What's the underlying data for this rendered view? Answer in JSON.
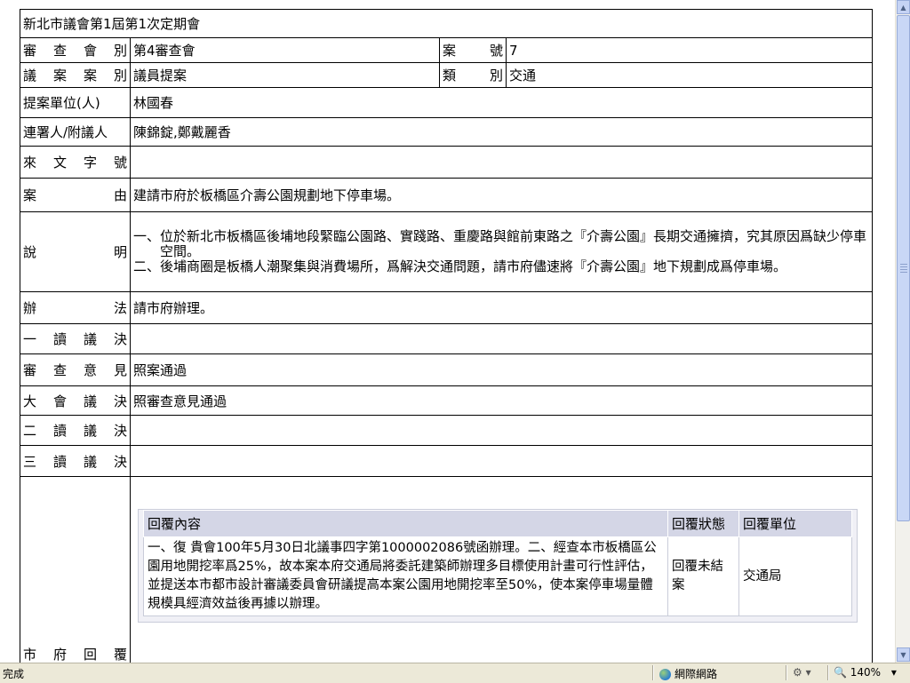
{
  "title": "新北市議會第1屆第1次定期會",
  "review": {
    "label": "審　查　會　別",
    "label_chars": [
      "審",
      "查",
      "會",
      "別"
    ],
    "value": "第4審查會"
  },
  "case_no": {
    "label_chars": [
      "案",
      "號"
    ],
    "value": "7"
  },
  "category": {
    "label_chars": [
      "議",
      "案",
      "案",
      "別"
    ],
    "value": "議員提案"
  },
  "type": {
    "label_chars": [
      "類",
      "別"
    ],
    "value": "交通"
  },
  "proposer": {
    "label": "提案單位(人)",
    "value": "林國春"
  },
  "cosigner": {
    "label": "連署人/附議人",
    "value": "陳錦錠,鄭戴麗香"
  },
  "doc_no": {
    "label_chars": [
      "來",
      "文",
      "字",
      "號"
    ],
    "value": ""
  },
  "reason": {
    "label_chars": [
      "案",
      "由"
    ],
    "value": "建請市府於板橋區介壽公園規劃地下停車場。"
  },
  "explanation": {
    "label_chars": [
      "說",
      "明"
    ],
    "items": [
      {
        "num": "一、",
        "text": "位於新北市板橋區後埔地段緊臨公園路、實踐路、重慶路與館前東路之『介壽公園』長期交通擁擠，究其原因爲缺少停車空間。"
      },
      {
        "num": "二、",
        "text": "後埔商圈是板橋人潮聚集與消費場所，爲解決交通問題，請市府儘速將『介壽公園』地下規劃成爲停車場。"
      }
    ]
  },
  "method": {
    "label_chars": [
      "辦",
      "法"
    ],
    "value": "請市府辦理。"
  },
  "first_reading": {
    "label_chars": [
      "一",
      "讀",
      "議",
      "決"
    ],
    "value": ""
  },
  "review_opinion": {
    "label_chars": [
      "審",
      "查",
      "意",
      "見"
    ],
    "value": "照案通過"
  },
  "assembly": {
    "label_chars": [
      "大",
      "會",
      "議",
      "決"
    ],
    "value": "照審查意見通過"
  },
  "second_reading": {
    "label_chars": [
      "二",
      "讀",
      "議",
      "決"
    ],
    "value": ""
  },
  "third_reading": {
    "label_chars": [
      "三",
      "讀",
      "議",
      "決"
    ],
    "value": ""
  },
  "reply": {
    "label_chars": [
      "市",
      "府",
      "回",
      "覆"
    ],
    "headers": [
      "回覆內容",
      "回覆狀態",
      "回覆單位"
    ],
    "rows": [
      {
        "content": "一、復 貴會100年5月30日北議事四字第1000002086號函辦理。二、經查本市板橋區公園用地開挖率爲25%，故本案本府交通局將委託建築師辦理多目標使用計畫可行性評估，並提送本市都市設計審議委員會研議提高本案公園用地開挖率至50%，使本案停車場量體規模具經濟效益後再據以辦理。",
        "status": "回覆未結案",
        "unit": "交通局"
      }
    ]
  },
  "statusbar": {
    "text": "完成",
    "zone": "網際網路",
    "zoom": "140%"
  },
  "colors": {
    "reply_header": "#d4d6e6",
    "reply_frame": "#f0f0f6",
    "statusbar": "#ece9d8"
  }
}
